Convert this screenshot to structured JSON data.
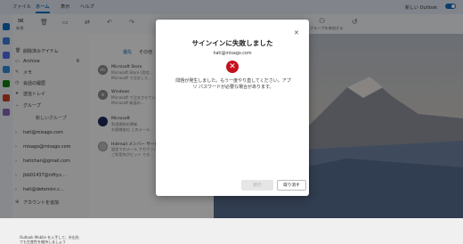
{
  "menu": {
    "tabs": [
      "ファイル",
      "ホーム",
      "表示",
      "ヘルプ"
    ],
    "active": "ホーム"
  },
  "new_outlook_label": "新しい Outlook",
  "ribbon": {
    "new_mail": "新規",
    "new_mail_sub": "メール",
    "group_label": "グループ",
    "group_action": "グループを参加する"
  },
  "folders": {
    "items": [
      {
        "label": "削除済みアイテム",
        "count": ""
      },
      {
        "label": "Archive",
        "count": "6"
      },
      {
        "label": "メモ",
        "count": ""
      },
      {
        "label": "会話の履歴",
        "count": ""
      },
      {
        "label": "送信トレイ",
        "count": ""
      },
      {
        "label": "グループ",
        "count": ""
      },
      {
        "label": "新しいグループ",
        "count": ""
      }
    ],
    "accounts": [
      "hati@misago.com",
      "misago@misago.com",
      "hatichan@gmail.com",
      "jbb01437@nifty.c...",
      "hati@detomini.c..."
    ],
    "add_account": "アカウントを追加",
    "promo": "Outlook Mobile を入手して、外出先でも生産性を維持しましょう"
  },
  "list": {
    "filter_focused": "優先",
    "filter_other": "その他",
    "messages": [
      {
        "initials": "MS",
        "sender": "Microsoft Store",
        "line1": "Microsoft Store (受信...",
        "line2": "Microsoft で注文した..."
      },
      {
        "initials": "W",
        "sender": "Windows",
        "line1": "Microsoft で注文させていただ...",
        "line2": "Microsoft 新設の..."
      },
      {
        "initials": "",
        "sender": "Microsoft",
        "line1": "利用規約の更新",
        "line2": "お客様各位 このメール..."
      },
      {
        "initials": "",
        "sender": "Hotmail メンバー サービス",
        "line1": "設定でのメール アカウント...",
        "line2": "ご利用先がビット でき..."
      }
    ]
  },
  "dialog": {
    "title": "サインインに失敗しました",
    "email": "hati@misago.com",
    "message": "問題が発生しました。もう一度やり直してください。アプリ パスワードが必要な場合があります。",
    "ok_label": "続行",
    "cancel_label": "取り消す",
    "error_color": "#c50f1f"
  },
  "colors": {
    "accent": "#0f6cbd"
  }
}
